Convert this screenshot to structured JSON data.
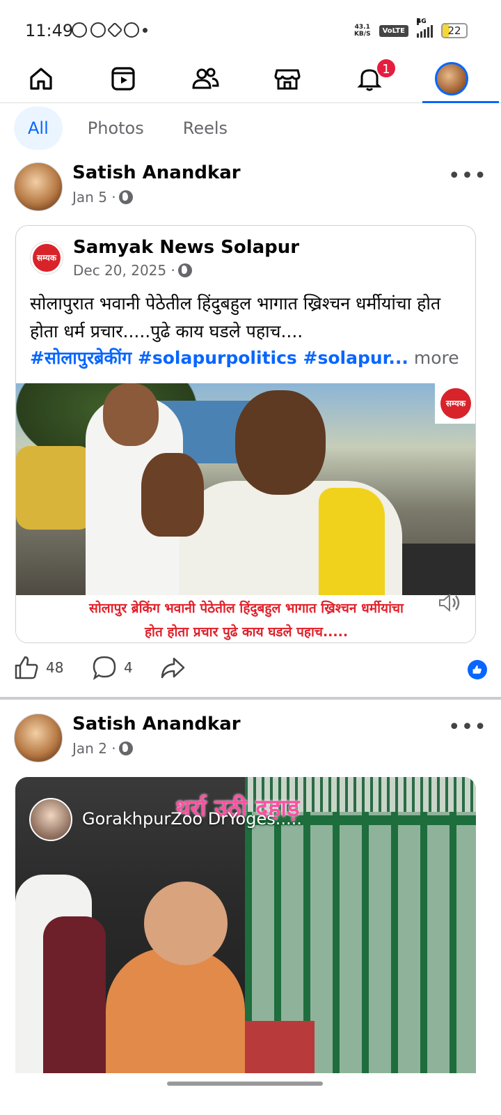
{
  "status_bar": {
    "time": "11:49",
    "net_speed_value": "43.1",
    "net_speed_unit": "KB/S",
    "volte": "VoLTE",
    "network": "4G",
    "battery": "22"
  },
  "nav": {
    "notification_count": "1",
    "active_tab": "profile"
  },
  "filters": [
    "All",
    "Photos",
    "Reels"
  ],
  "post1": {
    "author": "Satish Anandkar",
    "date": "Jan 5 ·",
    "more": "•••",
    "shared": {
      "page_name": "Samyak News Solapur",
      "date": "Dec 20, 2025 ·",
      "logo_text": "सम्यक",
      "text": "सोलापुरात भवानी पेठेतील हिंदुबहुल भागात ख्रिश्चन धर्मीयांचा होत होता धर्म प्रचार.....पुढे काय घडले पहाच....",
      "tags": "#सोलापुरब्रेकींग #solapurpolitics #solapur...",
      "more_link": "more",
      "caption_line1": "सोलापुर ब्रेकिंग भवानी पेठेतील हिंदुबहुल भागात ख्रिश्चन धर्मीयांचा",
      "caption_line2": "होत होता प्रचार पुढे काय घडले पहाच....."
    },
    "likes": "48",
    "comments": "4"
  },
  "post2": {
    "author": "Satish Anandkar",
    "date": "Jan 2 ·",
    "more": "•••",
    "video_overlay_text": "थर्रा उठी दहाड़",
    "video_source": "GorakhpurZoo DrYoges....."
  },
  "colors": {
    "accent": "#0866ff",
    "badge": "#e41e3f",
    "caption_red": "#e1202a"
  }
}
